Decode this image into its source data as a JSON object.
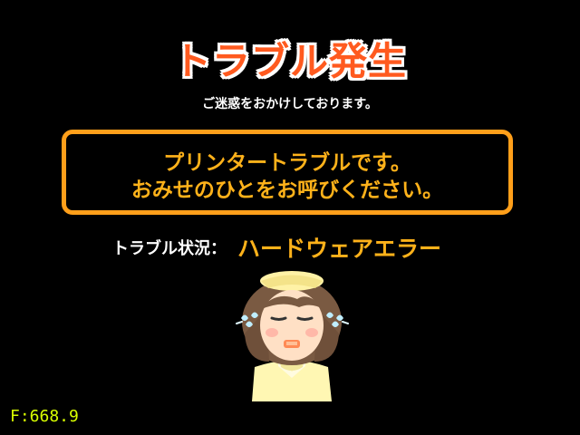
{
  "screen": {
    "title": "トラブル発生",
    "subtitle": "ご迷惑をおかけしております。",
    "message": {
      "line1": "プリンタートラブルです。",
      "line2": "おみせのひとをお呼びください。"
    },
    "status": {
      "label": "トラブル状況：",
      "value": "ハードウェアエラー"
    },
    "fps": "F:668.9"
  },
  "icons": {
    "character": "crying-staff-woman-icon"
  },
  "colors": {
    "background": "#000000",
    "title": "#ff5a1f",
    "title_outline": "#ffffff",
    "accent": "#ffb21a",
    "box_border": "#ff9f1a",
    "fps": "#d8ff00"
  }
}
